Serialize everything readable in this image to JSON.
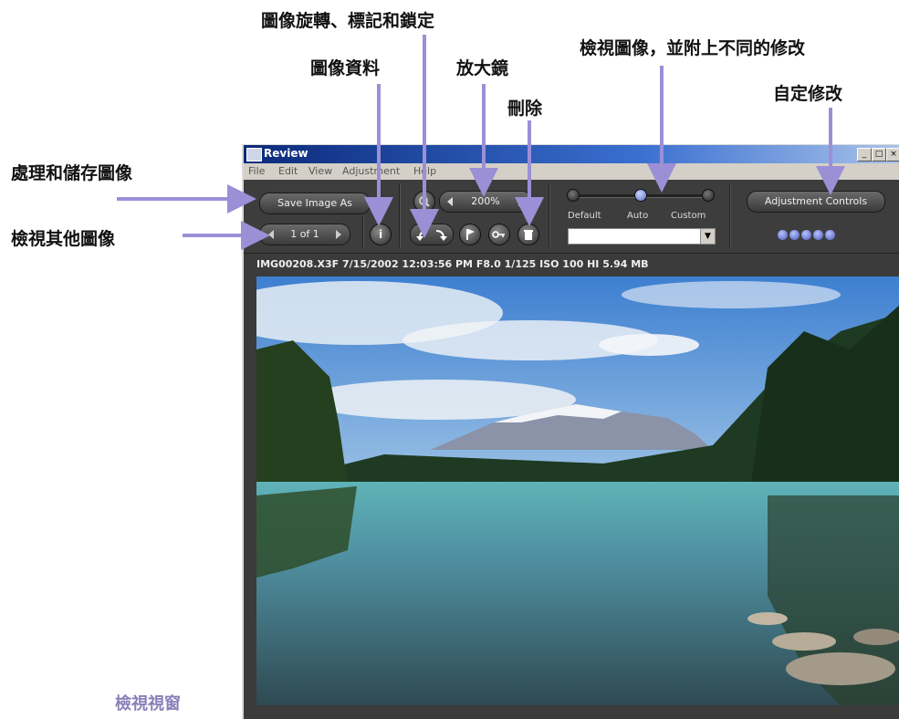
{
  "callouts": {
    "rotate_tag_lock": "圖像旋轉、標記和鎖定",
    "image_info": "圖像資料",
    "magnifier": "放大鏡",
    "view_with_adjustments": "檢視圖像，並附上不同的修改",
    "delete": "刪除",
    "custom_adjust": "自定修改",
    "process_save": "處理和儲存圖像",
    "view_other": "檢視其他圖像"
  },
  "caption": "檢視視窗",
  "window": {
    "title": "Review",
    "controls": [
      "_",
      "□",
      "×"
    ],
    "menu": [
      "File",
      "Edit",
      "View",
      "Adjustment",
      "Help"
    ]
  },
  "toolbar": {
    "save_label": "Save Image As",
    "nav_counter": "1 of 1",
    "info_glyph": "i",
    "zoom_value": "200%",
    "slider_labels": [
      "Default",
      "Auto",
      "Custom"
    ],
    "adjust_label": "Adjustment Controls",
    "dropdown_value": ""
  },
  "infobar": "IMG00208.X3F  7/15/2002  12:03:56 PM  F8.0  1/125  ISO 100  HI  5.94 MB",
  "colors": {
    "arrow": "#9b8fd6",
    "caption": "#8a7fb8",
    "slider_active": "#7b8ae0"
  },
  "icons": [
    "image-info-icon",
    "rotate-left-icon",
    "rotate-right-icon",
    "tag-flag-icon",
    "lock-key-icon",
    "trash-icon",
    "magnifier-icon"
  ]
}
